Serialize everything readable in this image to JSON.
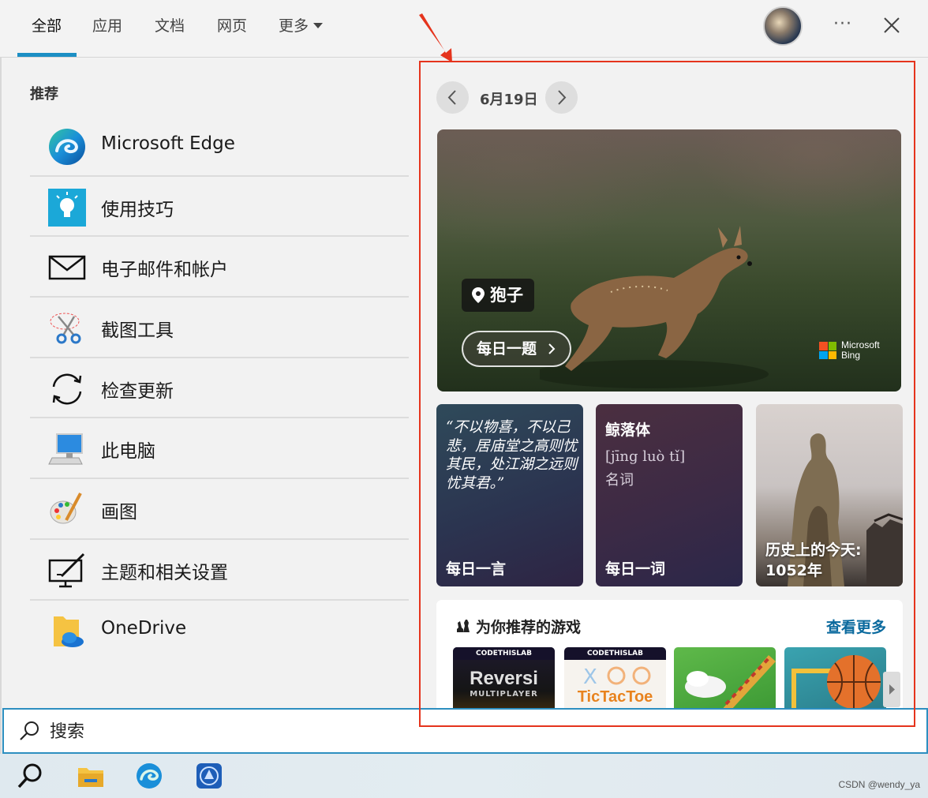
{
  "tabs": [
    {
      "label": "全部",
      "active": true
    },
    {
      "label": "应用"
    },
    {
      "label": "文档"
    },
    {
      "label": "网页"
    },
    {
      "label": "更多"
    }
  ],
  "header": {
    "more_options_glyph": "···",
    "close_icon": "close-icon",
    "avatar_icon": "user-avatar"
  },
  "recommended": {
    "heading": "推荐",
    "items": [
      {
        "label": "Microsoft Edge",
        "icon": "edge-icon"
      },
      {
        "label": "使用技巧",
        "icon": "tips-lightbulb-icon"
      },
      {
        "label": "电子邮件和帐户",
        "icon": "mail-envelope-icon"
      },
      {
        "label": "截图工具",
        "icon": "snipping-scissors-icon"
      },
      {
        "label": "检查更新",
        "icon": "refresh-sync-icon"
      },
      {
        "label": "此电脑",
        "icon": "computer-icon"
      },
      {
        "label": "画图",
        "icon": "paint-palette-icon"
      },
      {
        "label": "主题和相关设置",
        "icon": "theme-settings-icon"
      },
      {
        "label": "OneDrive",
        "icon": "onedrive-folder-icon"
      }
    ]
  },
  "today": {
    "date": "6月19日",
    "hero": {
      "location": "狍子",
      "quiz_button": "每日一题",
      "bing_brand_line1": "Microsoft",
      "bing_brand_line2": "Bing"
    },
    "cards": {
      "quote_text": "“不以物喜，不以己悲，居庙堂之高则忧其民，处江湖之远则忧其君。”",
      "quote_footer": "每日一言",
      "word_title": "鲸落体",
      "word_pinyin": "[jīng luò tǐ]",
      "word_pos": "名词",
      "word_footer": "每日一词",
      "history_title": "历史上的今天: 1052年"
    },
    "games": {
      "title": "为你推荐的游戏",
      "see_more": "查看更多",
      "tiles": [
        {
          "banner": "CODETHISLAB",
          "name": "Reversi",
          "sub": "MULTIPLAYER"
        },
        {
          "banner": "CODETHISLAB",
          "name": "TicTacToe"
        },
        {
          "name": ""
        },
        {
          "name": ""
        }
      ]
    }
  },
  "search": {
    "placeholder": "搜索"
  },
  "taskbar": {
    "items": [
      "search-icon",
      "file-explorer-icon",
      "edge-icon",
      "app-icon"
    ],
    "watermark": "CSDN @wendy_ya"
  },
  "colors": {
    "accent": "#1c8fc4",
    "annotation_red": "#e5341d",
    "link_blue": "#0b6a9e"
  }
}
